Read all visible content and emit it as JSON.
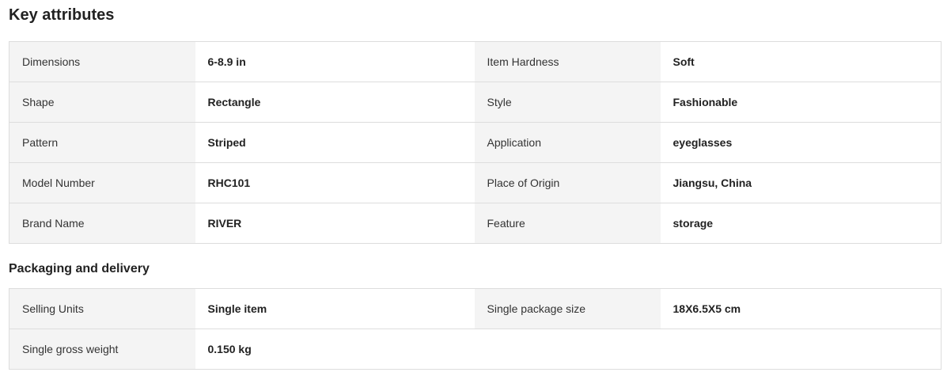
{
  "key_attributes": {
    "title": "Key attributes",
    "rows": [
      [
        {
          "label": "Dimensions",
          "value": "6-8.9 in"
        },
        {
          "label": "Item Hardness",
          "value": "Soft"
        }
      ],
      [
        {
          "label": "Shape",
          "value": "Rectangle"
        },
        {
          "label": "Style",
          "value": "Fashionable"
        }
      ],
      [
        {
          "label": "Pattern",
          "value": "Striped"
        },
        {
          "label": "Application",
          "value": "eyeglasses"
        }
      ],
      [
        {
          "label": "Model Number",
          "value": "RHC101"
        },
        {
          "label": "Place of Origin",
          "value": "Jiangsu, China"
        }
      ],
      [
        {
          "label": "Brand Name",
          "value": "RIVER"
        },
        {
          "label": "Feature",
          "value": "storage"
        }
      ]
    ]
  },
  "packaging": {
    "title": "Packaging and delivery",
    "rows": [
      [
        {
          "label": "Selling Units",
          "value": "Single item"
        },
        {
          "label": "Single package size",
          "value": "18X6.5X5 cm"
        }
      ],
      [
        {
          "label": "Single gross weight",
          "value": "0.150 kg"
        },
        {
          "label": "",
          "value": ""
        }
      ]
    ]
  }
}
